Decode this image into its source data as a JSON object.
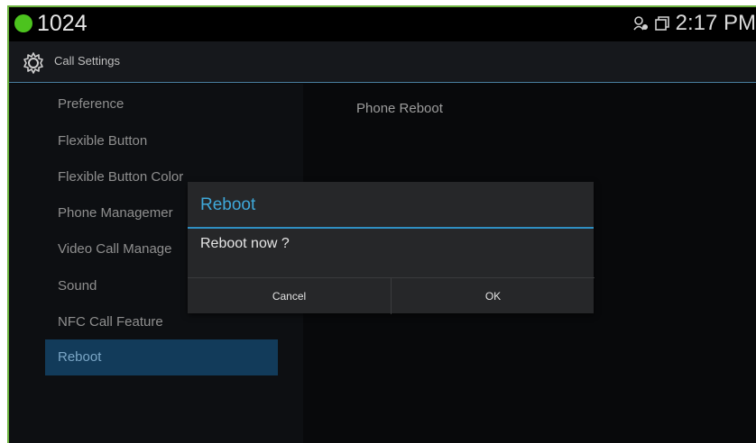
{
  "status_bar": {
    "extension": "1024",
    "time": "2:17 PM",
    "icons": [
      "network-settings-icon",
      "window-icon"
    ]
  },
  "header": {
    "title": "Call Settings",
    "icon": "gear-icon"
  },
  "menu": {
    "items": [
      {
        "label": "Preference"
      },
      {
        "label": "Flexible Button"
      },
      {
        "label": "Flexible Button Color"
      },
      {
        "label": "Phone Managemer"
      },
      {
        "label": "Video Call Manage"
      },
      {
        "label": "Sound"
      },
      {
        "label": "NFC Call Feature"
      },
      {
        "label": "Reboot"
      }
    ],
    "selected": "Reboot"
  },
  "content": {
    "label": "Phone Reboot"
  },
  "dialog": {
    "title": "Reboot",
    "message": "Reboot now ?",
    "cancel": "Cancel",
    "ok": "OK"
  },
  "colors": {
    "accent": "#3fa8d9",
    "status_green": "#4cc31e",
    "selected_bg": "#123b5a"
  }
}
